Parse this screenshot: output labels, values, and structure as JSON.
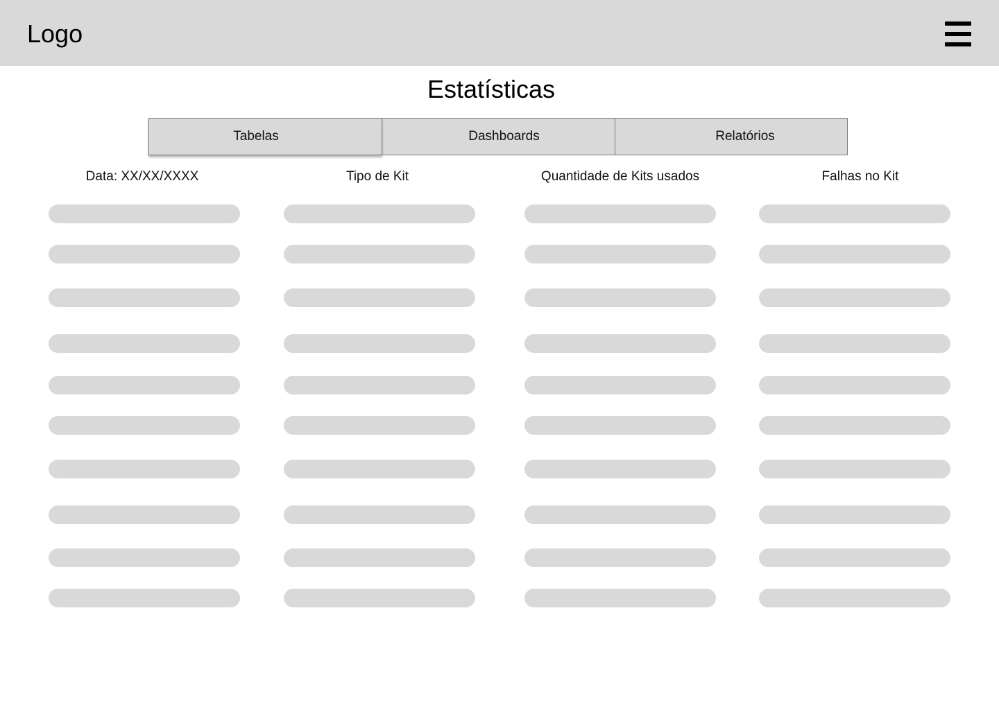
{
  "header": {
    "logo_text": "Logo",
    "menu_icon": "hamburger-menu-icon"
  },
  "page": {
    "title": "Estatísticas"
  },
  "tabs": [
    {
      "label": "Tabelas",
      "active": true
    },
    {
      "label": "Dashboards",
      "active": false
    },
    {
      "label": "Relatórios",
      "active": false
    }
  ],
  "table": {
    "columns": [
      "Data: XX/XX/XXXX",
      "Tipo de Kit",
      "Quantidade de Kits usados",
      "Falhas no Kit"
    ],
    "row_count": 10,
    "cell_state": "placeholder"
  },
  "colors": {
    "topbar_bg": "#d9d9d9",
    "tab_bg": "#d9d9d9",
    "tab_border": "#7a7a7a",
    "placeholder": "#d9d9d9"
  }
}
